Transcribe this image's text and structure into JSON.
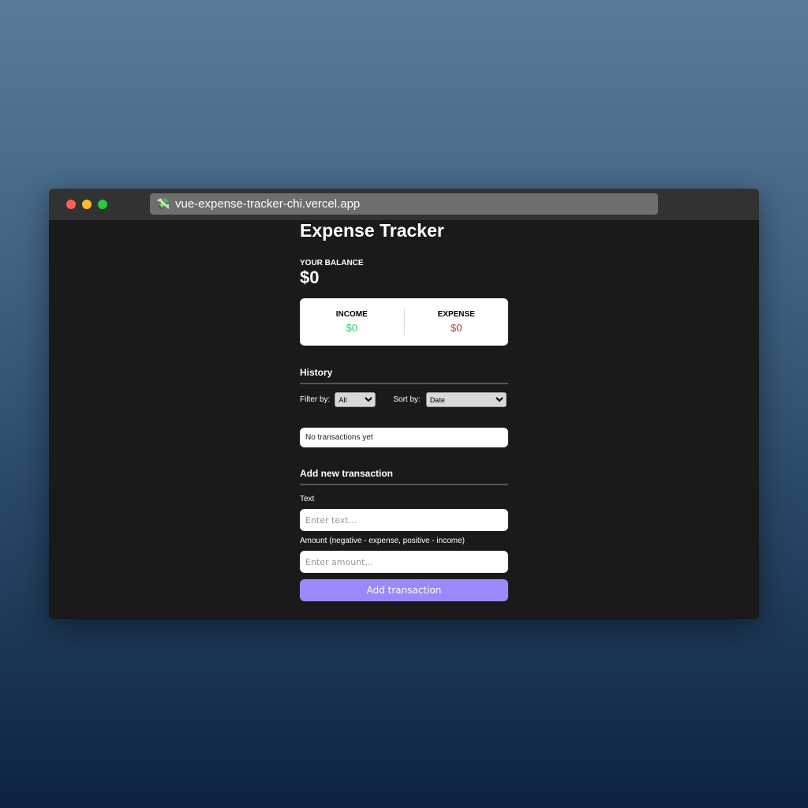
{
  "browser": {
    "url": "vue-expense-tracker-chi.vercel.app",
    "favicon": "money-with-wings-icon"
  },
  "app": {
    "title": "Expense Tracker",
    "balance_label": "YOUR BALANCE",
    "balance": "$0",
    "income_label": "INCOME",
    "income": "$0",
    "expense_label": "EXPENSE",
    "expense": "$0",
    "history_title": "History",
    "filter_label": "Filter by:",
    "filter_value": "All",
    "sort_label": "Sort by:",
    "sort_value": "Date",
    "empty_text": "No transactions yet",
    "add_title": "Add new transaction",
    "text_label": "Text",
    "text_placeholder": "Enter text...",
    "amount_label": "Amount (negative - expense, positive - income)",
    "amount_placeholder": "Enter amount...",
    "add_button": "Add transaction"
  },
  "colors": {
    "income": "#2ecc71",
    "expense": "#c0392b",
    "button": "#9b89fb"
  }
}
